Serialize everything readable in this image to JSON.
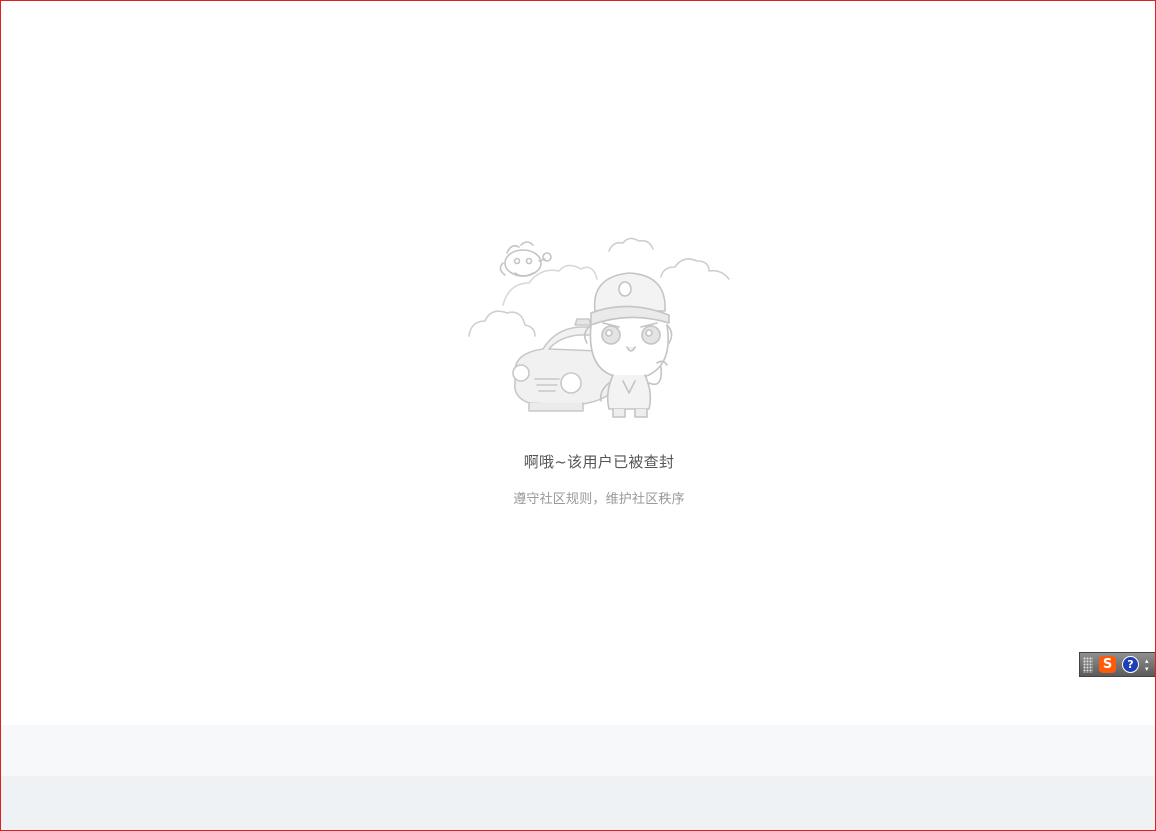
{
  "message": {
    "title": "啊哦~该用户已被查封",
    "subtitle": "遵守社区规则，维护社区秩序"
  },
  "illustration": {
    "icon": "police-officer-with-car-icon"
  },
  "ime_toolbar": {
    "logo_letter": "S",
    "help_glyph": "?"
  },
  "colors": {
    "frame": "#e02020",
    "title": "#555555",
    "subtitle": "#999999",
    "footer_band": "#f7f8f9",
    "footer_bottom": "#eff2f5"
  }
}
